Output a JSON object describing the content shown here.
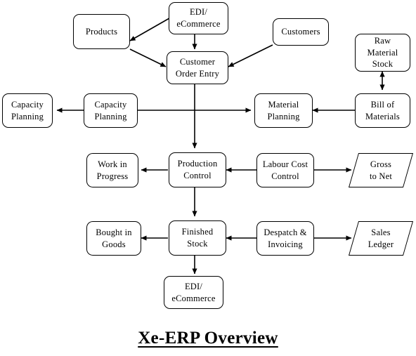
{
  "diagram": {
    "title": "Xe-ERP Overview",
    "type": "flowchart",
    "nodes": {
      "products": "Products",
      "edi_top": "EDI/\neCommerce",
      "customers": "Customers",
      "raw_material_stock": "Raw Material\nStock",
      "customer_order_entry": "Customer\nOrder Entry",
      "capacity_planning_left": "Capacity\nPlanning",
      "capacity_planning_mid": "Capacity\nPlanning",
      "material_planning": "Material\nPlanning",
      "bill_of_materials": "Bill of\nMaterials",
      "work_in_progress": "Work in\nProgress",
      "production_control": "Production\nControl",
      "labour_cost_control": "Labour Cost\nControl",
      "gross_to_net": "Gross\nto Net",
      "bought_in_goods": "Bought in\nGoods",
      "finished_stock": "Finished\nStock",
      "despatch_invoicing": "Despatch &\nInvoicing",
      "sales_ledger": "Sales\nLedger",
      "edi_bottom": "EDI/\neCommerce"
    },
    "node_lines": {
      "products": [
        "Products"
      ],
      "edi_top": [
        "EDI/",
        "eCommerce"
      ],
      "customers": [
        "Customers"
      ],
      "raw_material_stock": [
        "Raw Material",
        "Stock"
      ],
      "customer_order_entry": [
        "Customer",
        "Order Entry"
      ],
      "capacity_planning_left": [
        "Capacity",
        "Planning"
      ],
      "capacity_planning_mid": [
        "Capacity",
        "Planning"
      ],
      "material_planning": [
        "Material",
        "Planning"
      ],
      "bill_of_materials": [
        "Bill of",
        "Materials"
      ],
      "work_in_progress": [
        "Work in",
        "Progress"
      ],
      "production_control": [
        "Production",
        "Control"
      ],
      "labour_cost_control": [
        "Labour Cost",
        "Control"
      ],
      "gross_to_net": [
        "Gross",
        "to Net"
      ],
      "bought_in_goods": [
        "Bought in",
        "Goods"
      ],
      "finished_stock": [
        "Finished",
        "Stock"
      ],
      "despatch_invoicing": [
        "Despatch &",
        "Invoicing"
      ],
      "sales_ledger": [
        "Sales",
        "Ledger"
      ],
      "edi_bottom": [
        "EDI/",
        "eCommerce"
      ]
    },
    "edges": [
      {
        "from": "edi_top",
        "to": "products",
        "direction": "one-way"
      },
      {
        "from": "edi_top",
        "to": "customer_order_entry",
        "direction": "one-way"
      },
      {
        "from": "products",
        "to": "customer_order_entry",
        "direction": "one-way"
      },
      {
        "from": "customers",
        "to": "customer_order_entry",
        "direction": "one-way"
      },
      {
        "from": "raw_material_stock",
        "to": "bill_of_materials",
        "direction": "two-way"
      },
      {
        "from": "customer_order_entry",
        "to": "production_control",
        "direction": "one-way"
      },
      {
        "from": "capacity_planning_mid",
        "to": "capacity_planning_left",
        "direction": "one-way"
      },
      {
        "from": "capacity_planning_mid",
        "to": "material_planning",
        "direction": "one-way"
      },
      {
        "from": "bill_of_materials",
        "to": "material_planning",
        "direction": "one-way"
      },
      {
        "from": "production_control",
        "to": "work_in_progress",
        "direction": "one-way"
      },
      {
        "from": "labour_cost_control",
        "to": "production_control",
        "direction": "one-way"
      },
      {
        "from": "labour_cost_control",
        "to": "gross_to_net",
        "direction": "one-way"
      },
      {
        "from": "production_control",
        "to": "finished_stock",
        "direction": "one-way"
      },
      {
        "from": "finished_stock",
        "to": "bought_in_goods",
        "direction": "one-way"
      },
      {
        "from": "despatch_invoicing",
        "to": "finished_stock",
        "direction": "one-way"
      },
      {
        "from": "despatch_invoicing",
        "to": "sales_ledger",
        "direction": "one-way"
      },
      {
        "from": "finished_stock",
        "to": "edi_bottom",
        "direction": "one-way"
      }
    ],
    "colors": {
      "stroke": "#000000",
      "fill": "#ffffff",
      "text": "#000000"
    }
  }
}
